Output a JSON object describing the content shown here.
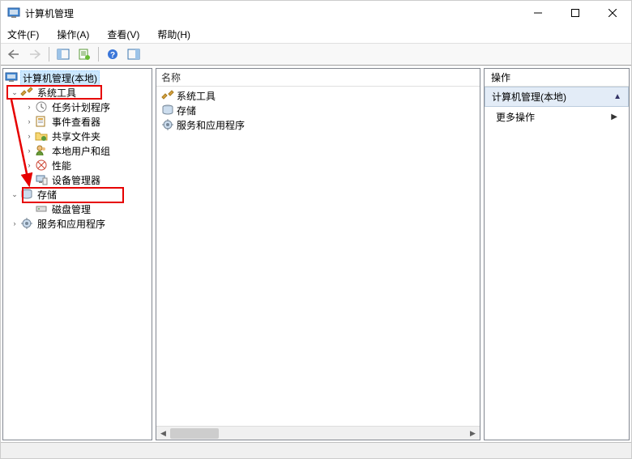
{
  "window": {
    "title": "计算机管理"
  },
  "menu": {
    "file": "文件(F)",
    "action": "操作(A)",
    "view": "查看(V)",
    "help": "帮助(H)"
  },
  "tree": {
    "root": "计算机管理(本地)",
    "system_tools": "系统工具",
    "task_scheduler": "任务计划程序",
    "event_viewer": "事件查看器",
    "shared_folders": "共享文件夹",
    "local_users": "本地用户和组",
    "performance": "性能",
    "device_manager": "设备管理器",
    "storage": "存储",
    "disk_mgmt": "磁盘管理",
    "services_apps": "服务和应用程序"
  },
  "list": {
    "header_name": "名称",
    "system_tools": "系统工具",
    "storage": "存储",
    "services_apps": "服务和应用程序"
  },
  "actions": {
    "header": "操作",
    "section": "计算机管理(本地)",
    "more": "更多操作"
  }
}
